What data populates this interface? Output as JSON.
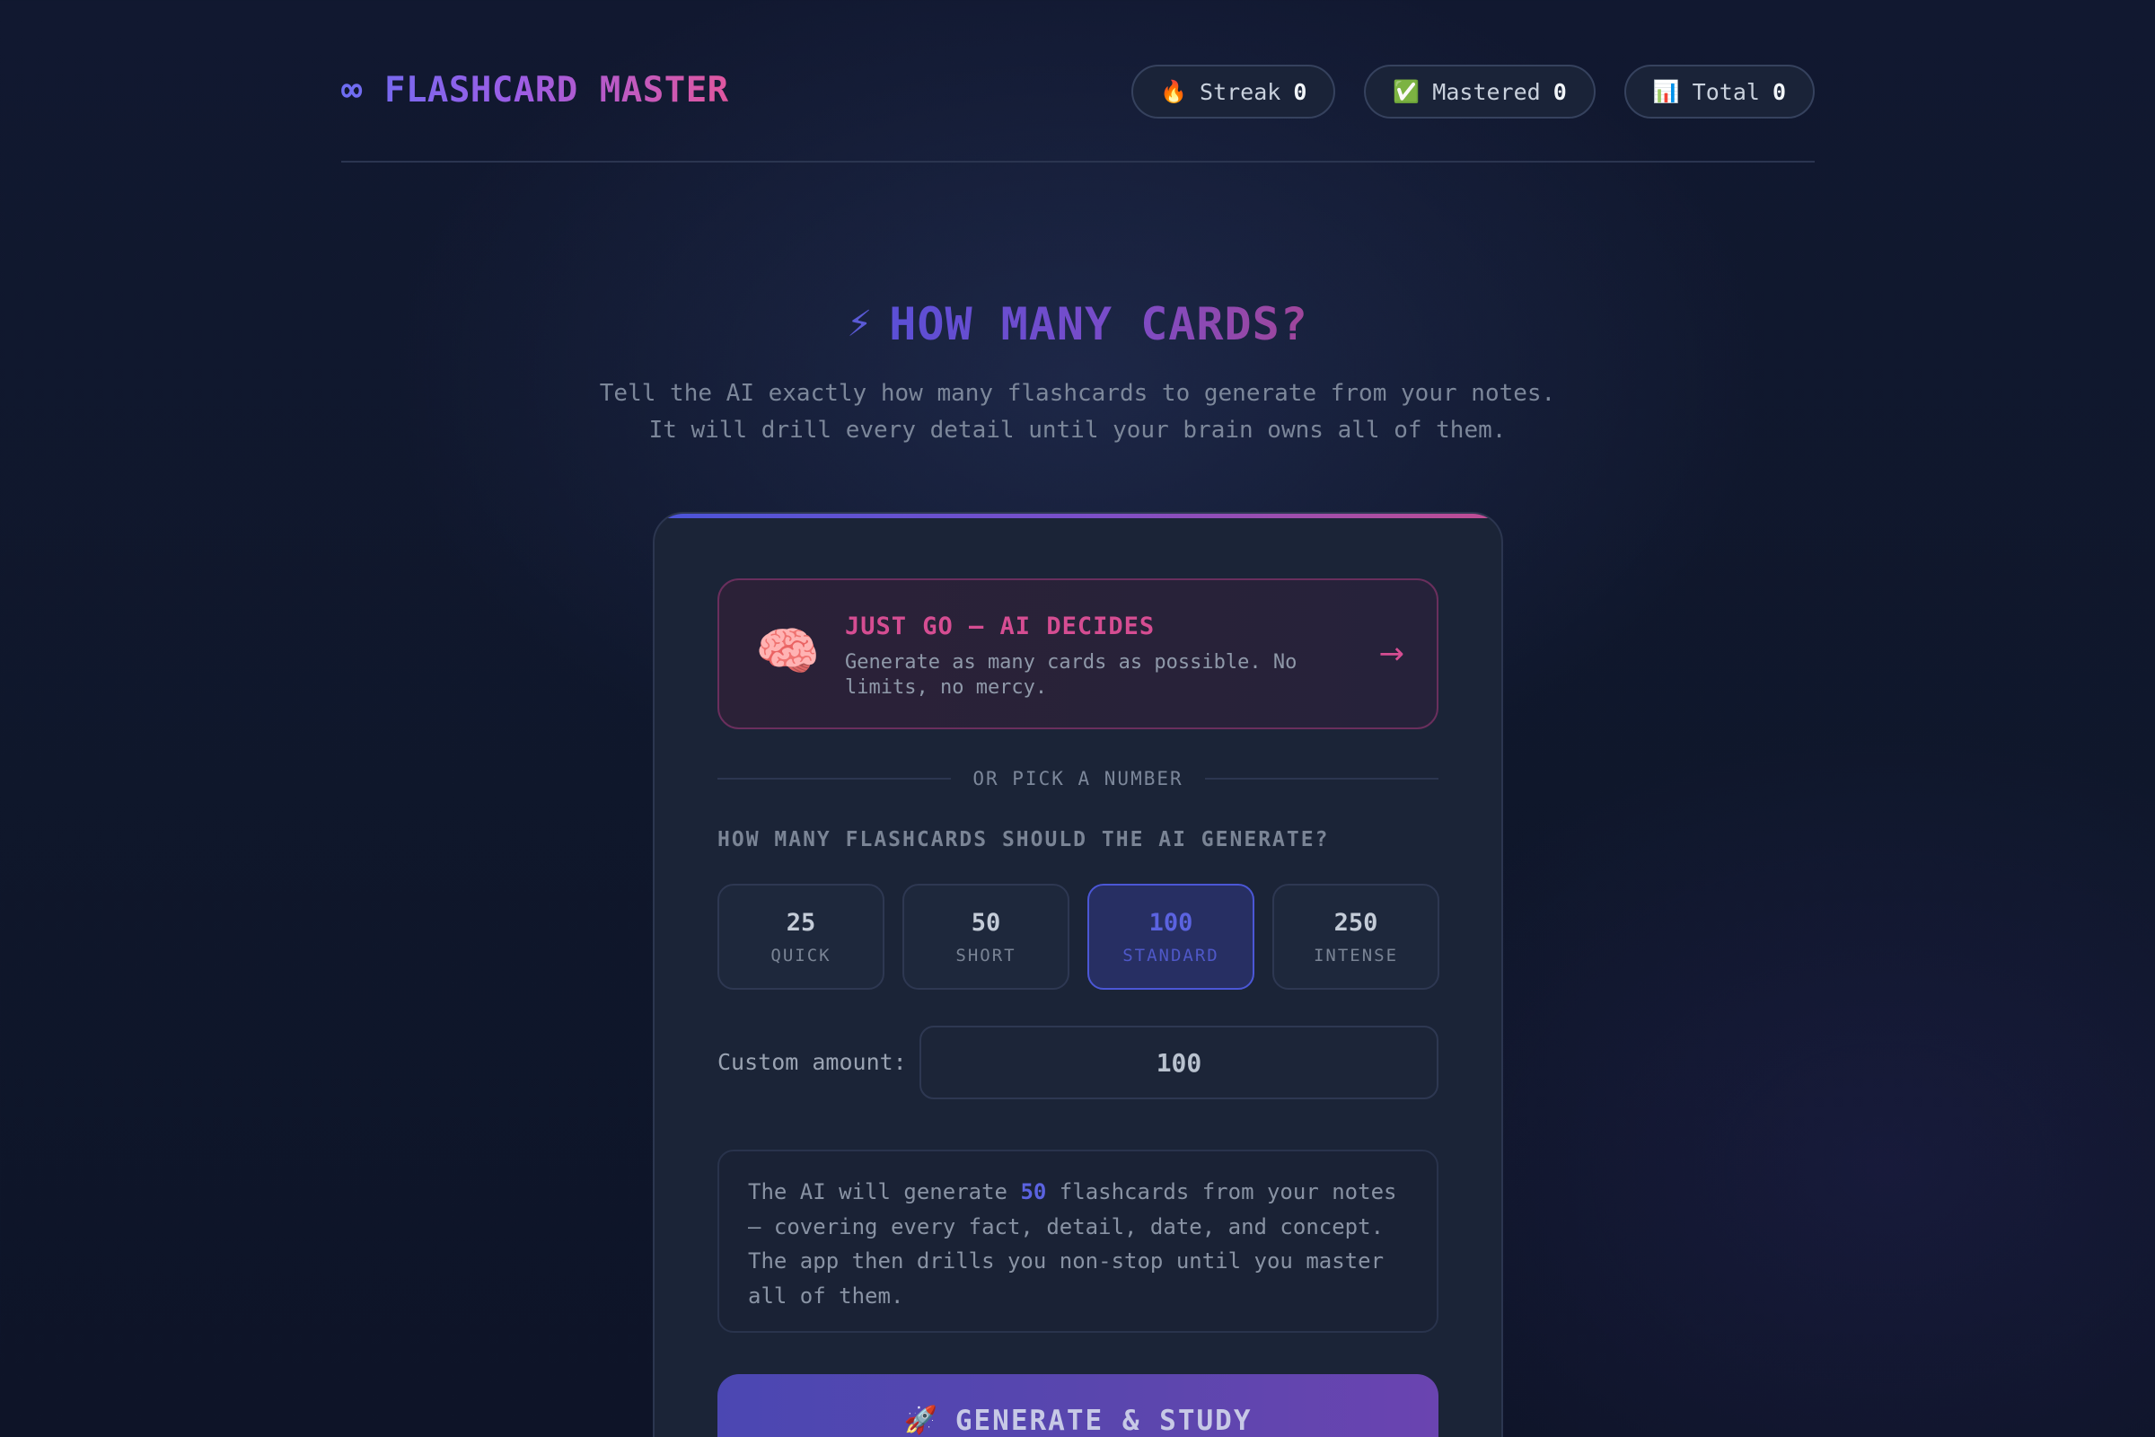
{
  "app": {
    "logo_symbol": "∞",
    "logo_text": "FLASHCARD MASTER"
  },
  "stats": [
    {
      "icon": "fire-icon",
      "emoji": "🔥",
      "label": "Streak",
      "value": "0"
    },
    {
      "icon": "check-icon",
      "emoji": "✅",
      "label": "Mastered",
      "value": "0"
    },
    {
      "icon": "bar-chart-icon",
      "emoji": "📊",
      "label": "Total",
      "value": "0"
    }
  ],
  "hero": {
    "bolt": "⚡",
    "title": "HOW MANY CARDS?",
    "subtitle_line1": "Tell the AI exactly how many flashcards to generate from your notes.",
    "subtitle_line2": "It will drill every detail until your brain owns all of them."
  },
  "ai_decides": {
    "emoji": "🧠",
    "title": "JUST GO — AI DECIDES",
    "description": "Generate as many cards as possible. No limits, no mercy.",
    "arrow": "→"
  },
  "divider_text": "OR PICK A NUMBER",
  "question": "HOW MANY FLASHCARDS SHOULD THE AI GENERATE?",
  "presets": [
    {
      "value": "25",
      "label": "QUICK",
      "selected": false
    },
    {
      "value": "50",
      "label": "SHORT",
      "selected": false
    },
    {
      "value": "100",
      "label": "STANDARD",
      "selected": true
    },
    {
      "value": "250",
      "label": "INTENSE",
      "selected": false
    }
  ],
  "custom": {
    "label": "Custom amount:",
    "value": "100"
  },
  "info": {
    "prefix": "The AI will generate ",
    "count": "50",
    "suffix": " flashcards from your notes — covering every fact, detail, date, and concept. The app then drills you non-stop until you master all of them."
  },
  "generate": {
    "emoji": "🚀",
    "label": "GENERATE & STUDY"
  },
  "colors": {
    "accent_indigo": "#5b63e0",
    "accent_pink": "#d54d92",
    "background": "#0f172b"
  }
}
